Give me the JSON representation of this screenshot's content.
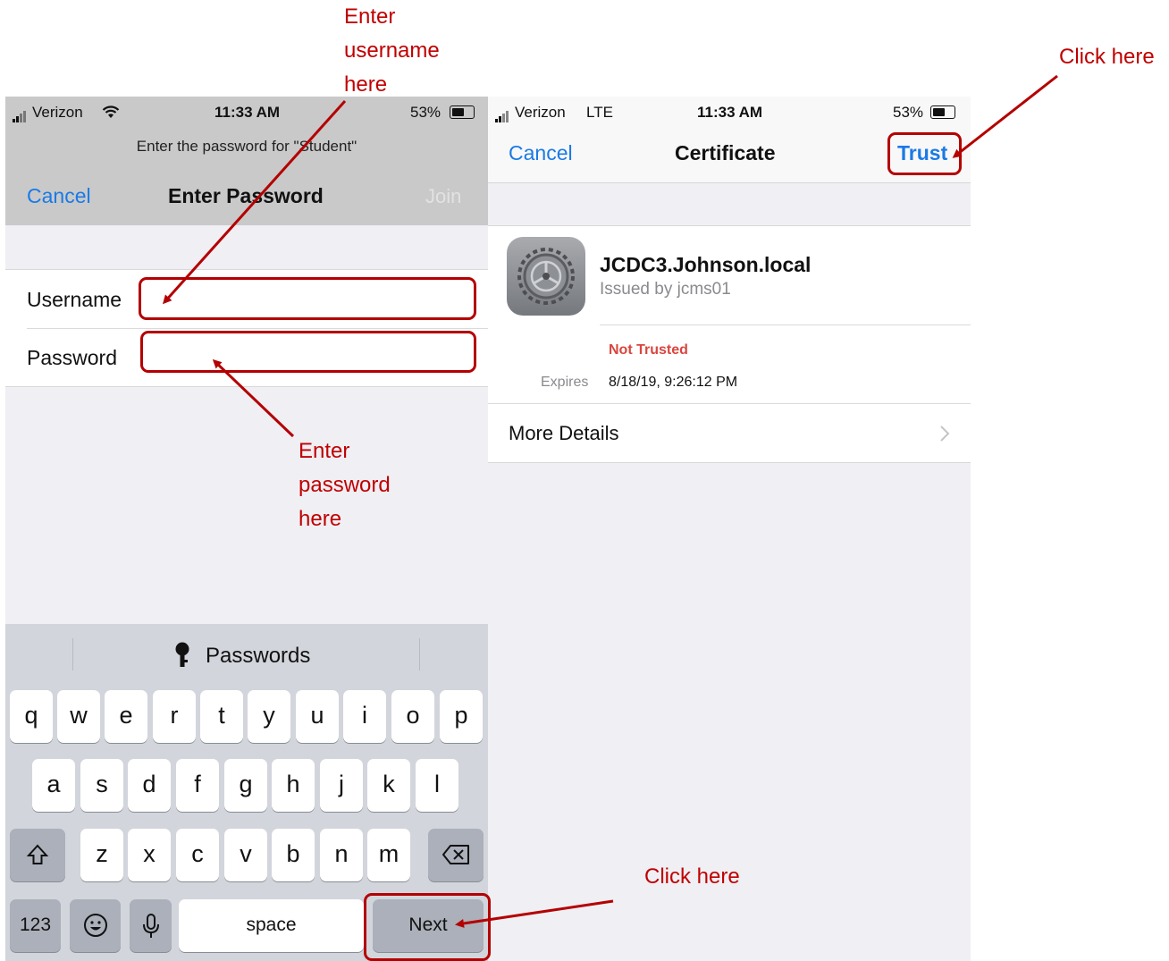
{
  "left_screen": {
    "status": {
      "carrier": "Verizon",
      "time": "11:33 AM",
      "battery": "53%"
    },
    "prompt": "Enter the password for \"Student\"",
    "nav": {
      "cancel": "Cancel",
      "title": "Enter Password",
      "join": "Join"
    },
    "form": {
      "username_label": "Username",
      "password_label": "Password",
      "username_value": "",
      "password_value": ""
    },
    "keyboard": {
      "suggestion": "Passwords",
      "row1": [
        "q",
        "w",
        "e",
        "r",
        "t",
        "y",
        "u",
        "i",
        "o",
        "p"
      ],
      "row2": [
        "a",
        "s",
        "d",
        "f",
        "g",
        "h",
        "j",
        "k",
        "l"
      ],
      "row3": [
        "z",
        "x",
        "c",
        "v",
        "b",
        "n",
        "m"
      ],
      "numbers_key": "123",
      "space_key": "space",
      "next_key": "Next"
    }
  },
  "right_screen": {
    "status": {
      "carrier": "Verizon",
      "network": "LTE",
      "time": "11:33 AM",
      "battery": "53%"
    },
    "nav": {
      "cancel": "Cancel",
      "title": "Certificate",
      "trust": "Trust"
    },
    "certificate": {
      "name": "JCDC3.Johnson.local",
      "issuer": "Issued by jcms01",
      "status": "Not Trusted",
      "expires_label": "Expires",
      "expires_value": "8/18/19, 9:26:12 PM",
      "more_details": "More Details"
    }
  },
  "annotations": {
    "username_note": [
      "Enter",
      "username",
      "here"
    ],
    "password_note": [
      "Enter",
      "password",
      "here"
    ],
    "trust_note": "Click here",
    "next_note": "Click here",
    "color": "#c00000"
  }
}
